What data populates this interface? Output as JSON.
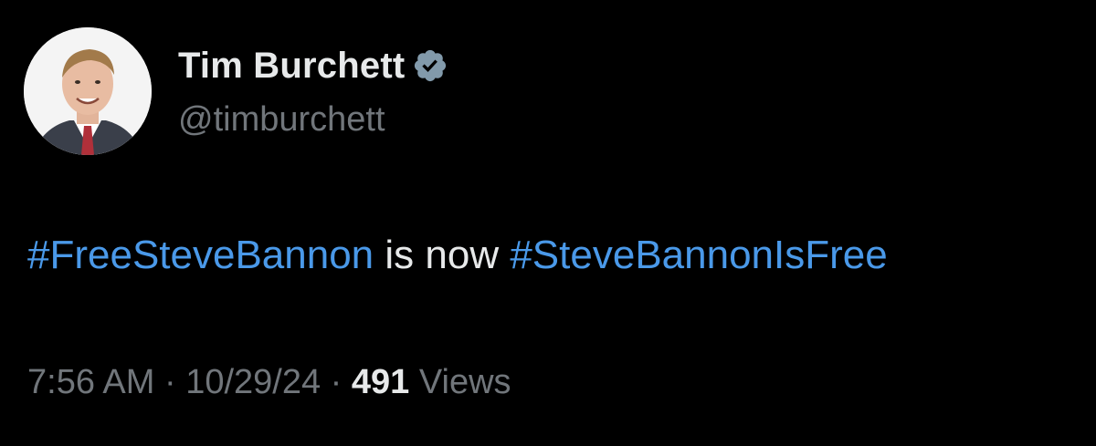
{
  "author": {
    "display_name": "Tim Burchett",
    "handle": "@timburchett",
    "verified_icon": "verified-badge-icon",
    "avatar_icon": "profile-photo-avatar"
  },
  "tweet": {
    "hashtag_1": "#FreeSteveBannon",
    "middle_text": " is now ",
    "hashtag_2": "#SteveBannonIsFree"
  },
  "meta": {
    "time": "7:56 AM",
    "separator": " · ",
    "date": "10/29/24",
    "views_count": "491",
    "views_label": " Views"
  },
  "colors": {
    "background": "#000000",
    "primary_text": "#e7e9ea",
    "secondary_text": "#71767b",
    "hashtag": "#4a99e9",
    "badge": "#829aab"
  }
}
